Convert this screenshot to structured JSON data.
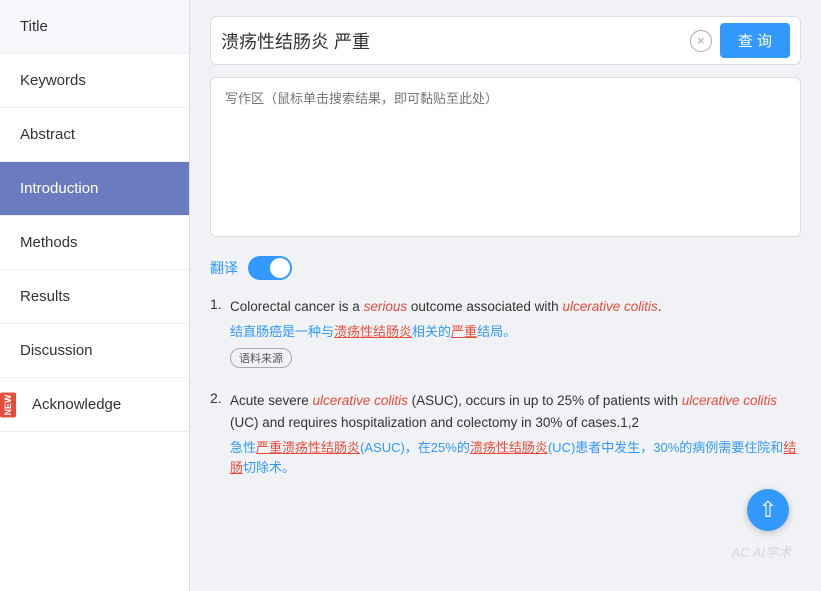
{
  "sidebar": {
    "items": [
      {
        "label": "Title",
        "active": false,
        "new_badge": false
      },
      {
        "label": "Keywords",
        "active": false,
        "new_badge": false
      },
      {
        "label": "Abstract",
        "active": false,
        "new_badge": false
      },
      {
        "label": "Introduction",
        "active": true,
        "new_badge": false
      },
      {
        "label": "Methods",
        "active": false,
        "new_badge": false
      },
      {
        "label": "Results",
        "active": false,
        "new_badge": false
      },
      {
        "label": "Discussion",
        "active": false,
        "new_badge": false
      },
      {
        "label": "Acknowledge",
        "active": false,
        "new_badge": true
      }
    ]
  },
  "search": {
    "value": "溃疡性结肠炎 严重",
    "clear_label": "×",
    "button_label": "查 询"
  },
  "writing_area": {
    "placeholder": "写作区（鼠标单击搜索结果，即可黏贴至此处）"
  },
  "translate": {
    "label": "翻译"
  },
  "results": [
    {
      "number": "1.",
      "en_parts": [
        {
          "text": "Colorectal cancer is a ",
          "style": "normal"
        },
        {
          "text": "serious",
          "style": "italic-red"
        },
        {
          "text": " outcome associated with ",
          "style": "normal"
        },
        {
          "text": "ulcerative colitis",
          "style": "italic-red"
        },
        {
          "text": ".",
          "style": "normal"
        }
      ],
      "cn": "结直肠癌是一种与溃疡性结肠炎相关的严重结局。",
      "source": "语料来源"
    },
    {
      "number": "2.",
      "en_parts": [
        {
          "text": "Acute severe ",
          "style": "normal"
        },
        {
          "text": "ulcerative colitis",
          "style": "italic-red"
        },
        {
          "text": " (ASUC), occurs in up to 25% of patients with ",
          "style": "normal"
        },
        {
          "text": "ulcerative colitis",
          "style": "italic-red"
        },
        {
          "text": " (UC) and requires hospitalization and colectomy in 30% of cases.1,2",
          "style": "normal"
        }
      ],
      "cn": "急性严重溃疡性结肠炎(ASUC)，在25%的溃疡性结肠炎(UC)患者中发生，30%的病例需要住院和结肠切除术。"
    }
  ],
  "watermark": "AC AI学术"
}
